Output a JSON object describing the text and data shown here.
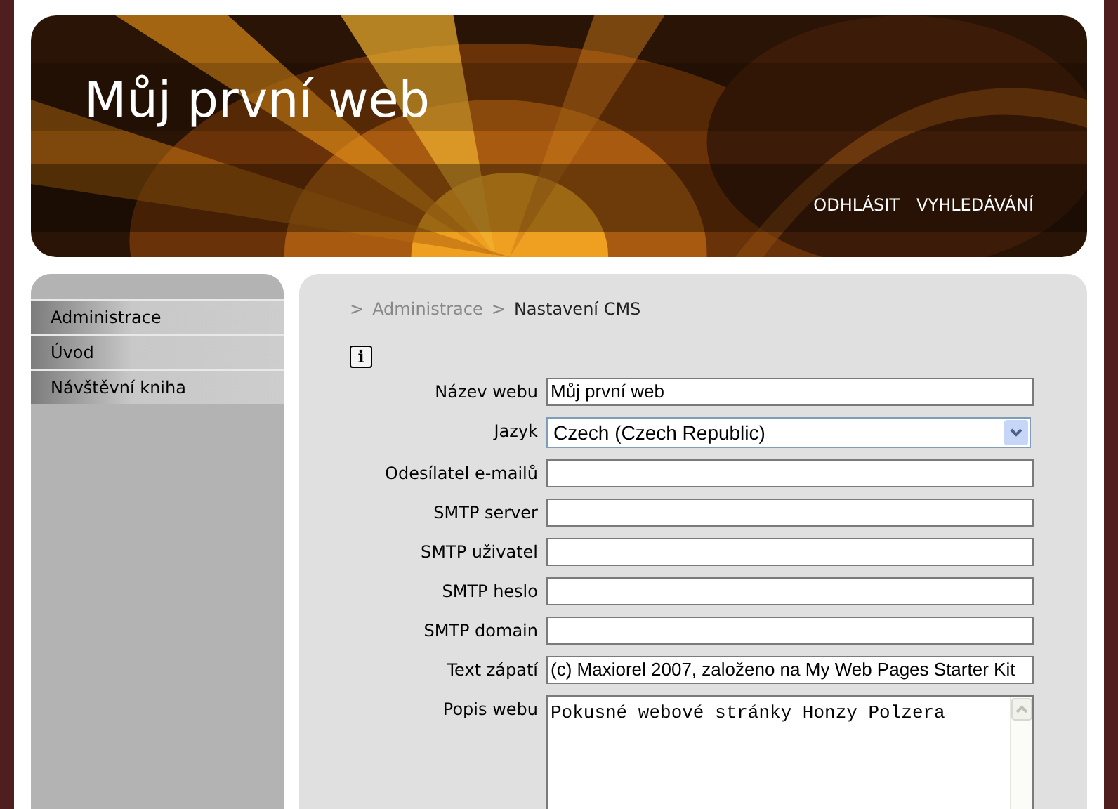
{
  "header": {
    "title": "Můj první web",
    "nav": [
      "ODHLÁSIT",
      "VYHLEDÁVÁNÍ"
    ]
  },
  "sidebar": {
    "items": [
      "Administrace",
      "Úvod",
      "Návštěvní kniha"
    ]
  },
  "breadcrumb": [
    {
      "separator": ">",
      "label": "Administrace",
      "current": false
    },
    {
      "separator": ">",
      "label": "Nastavení CMS",
      "current": true
    }
  ],
  "info_button": "i",
  "form": [
    {
      "label": "Název webu",
      "kind": "text",
      "value": "Můj první web"
    },
    {
      "label": "Jazyk",
      "kind": "select",
      "value": "Czech (Czech Republic)"
    },
    {
      "label": "Odesílatel e-mailů",
      "kind": "text"
    },
    {
      "label": "SMTP server",
      "kind": "text"
    },
    {
      "label": "SMTP uživatel",
      "kind": "text"
    },
    {
      "label": "SMTP heslo",
      "kind": "text"
    },
    {
      "label": "SMTP domain",
      "kind": "text"
    },
    {
      "label": "Text zápatí",
      "kind": "text",
      "value": "(c) Maxiorel 2007, založeno na My Web Pages Starter Kit"
    },
    {
      "label": "Popis webu",
      "kind": "textarea",
      "value": "Pokusné webové stránky Honzy Polzera"
    }
  ]
}
